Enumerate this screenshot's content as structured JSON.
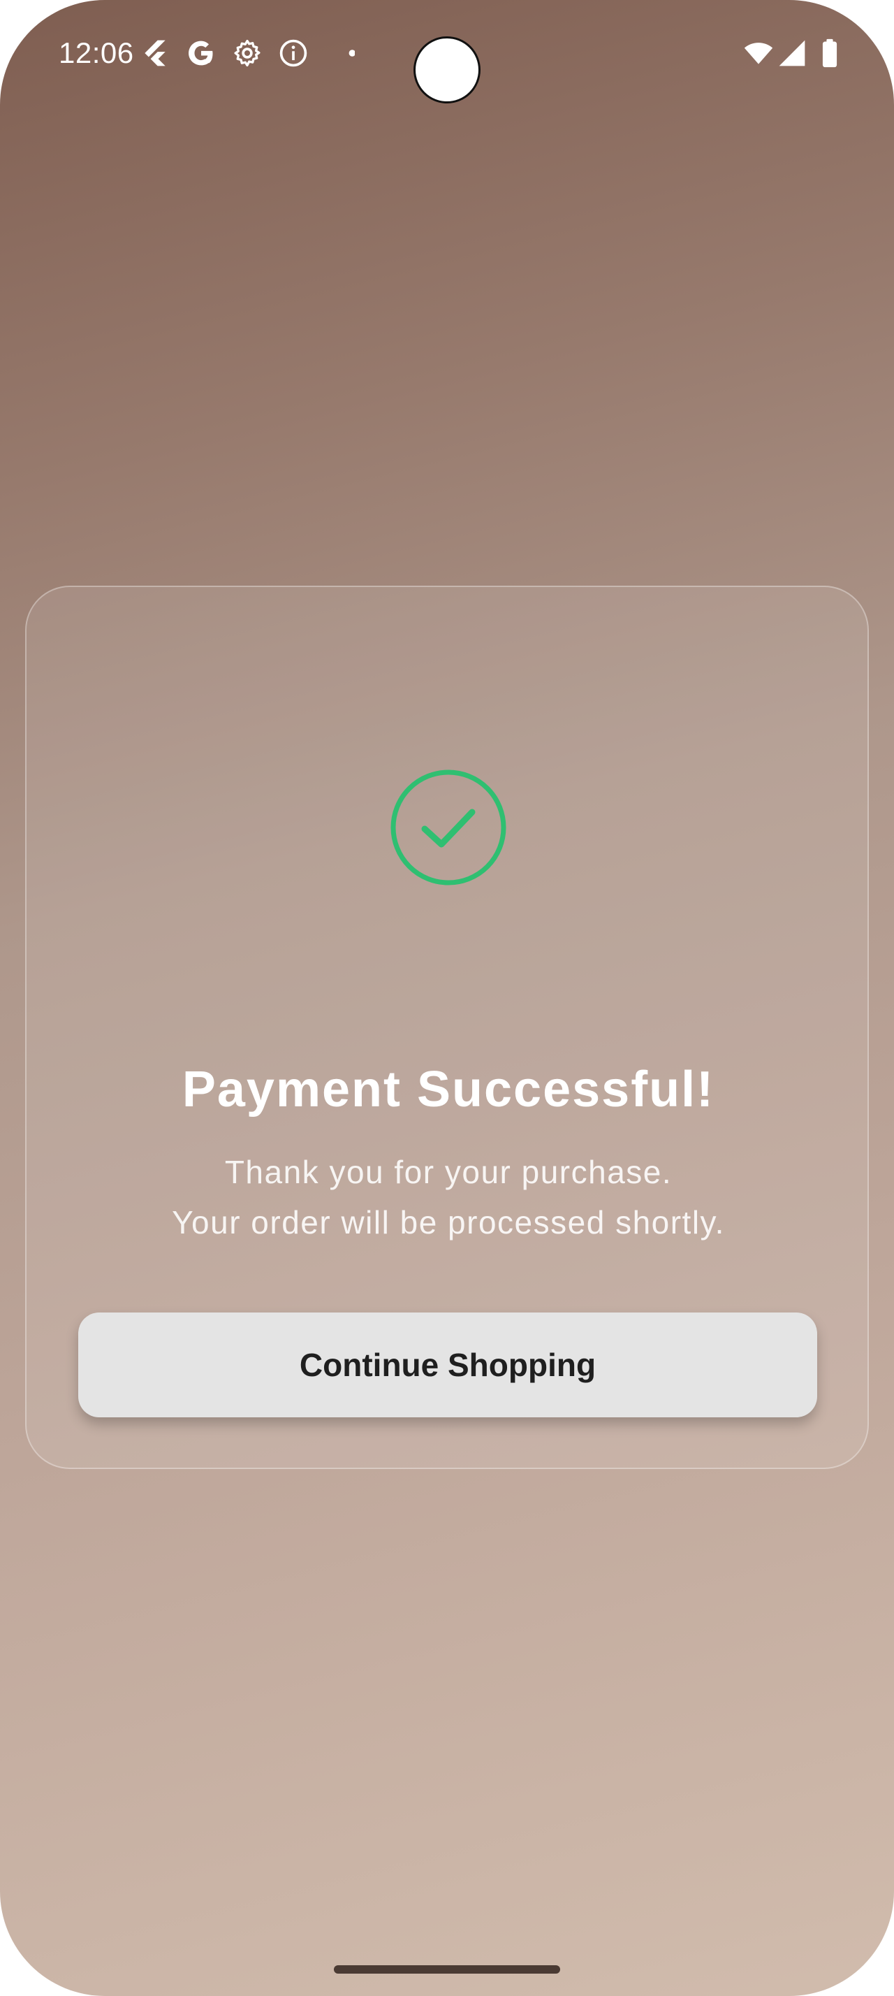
{
  "status_bar": {
    "time": "12:06",
    "icons": [
      "flutter-icon",
      "google-icon",
      "settings-gear-icon",
      "info-icon",
      "notification-dot-icon",
      "wifi-icon",
      "cellular-signal-icon",
      "battery-icon"
    ]
  },
  "card": {
    "icon": "check-circle-icon",
    "icon_color": "#2fbf71",
    "title": "Payment Successful!",
    "message_line1": "Thank you for your purchase.",
    "message_line2": "Your order will be processed shortly.",
    "button_label": "Continue Shopping"
  },
  "colors": {
    "gradient_top": "#7f5e51",
    "gradient_bottom": "#d1bcad",
    "button_bg": "#e4e4e4",
    "success_green": "#2fbf71"
  }
}
